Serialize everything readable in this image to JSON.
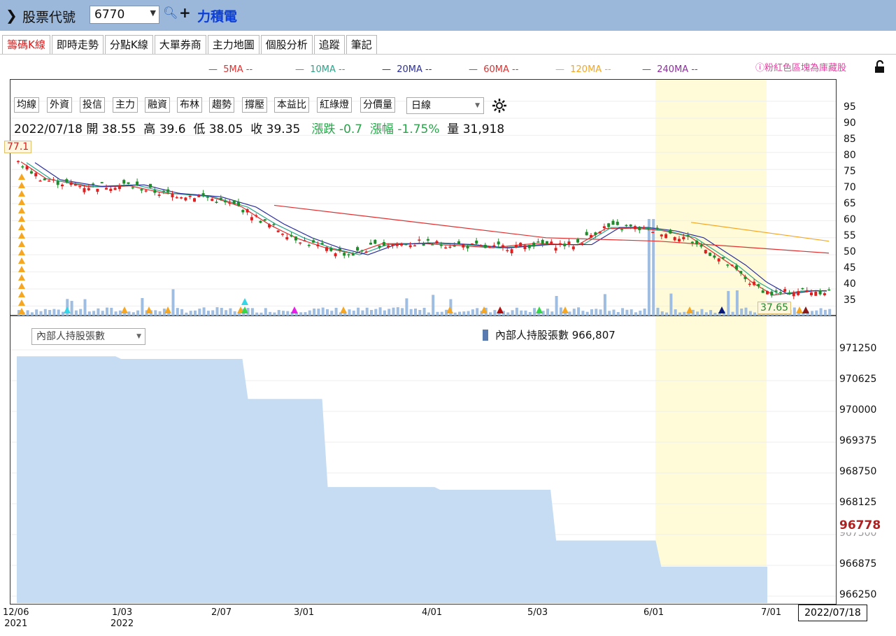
{
  "header": {
    "stock_code_label": "股票代號",
    "stock_code": "6770",
    "stock_name": "力積電"
  },
  "tabs": [
    {
      "label": "籌碼K線",
      "active": true
    },
    {
      "label": "即時走勢"
    },
    {
      "label": "分點K線"
    },
    {
      "label": "大單券商"
    },
    {
      "label": "主力地圖"
    },
    {
      "label": "個股分析"
    },
    {
      "label": "追蹤"
    },
    {
      "label": "筆記"
    }
  ],
  "ma_legend": [
    {
      "label": "5MA --",
      "color": "#e03030"
    },
    {
      "label": "10MA --",
      "color": "#2aa58a"
    },
    {
      "label": "20MA --",
      "color": "#2b2f9c"
    },
    {
      "label": "60MA --",
      "color": "#e03030"
    },
    {
      "label": "120MA --",
      "color": "#f5a623"
    },
    {
      "label": "240MA --",
      "color": "#8e2fa0"
    }
  ],
  "pink_note": "粉紅色區塊為庫藏股",
  "toolbar": {
    "buttons": [
      "均線",
      "外資",
      "投信",
      "主力",
      "融資",
      "布林",
      "趨勢",
      "撐壓",
      "本益比",
      "紅綠燈",
      "分價量"
    ],
    "period": "日線"
  },
  "quote": {
    "date": "2022/07/18",
    "open_label": "開",
    "open": "38.55",
    "high_label": "高",
    "high": "39.6",
    "low_label": "低",
    "low": "38.05",
    "close_label": "收",
    "close": "39.35",
    "change_label": "漲跌",
    "change": "-0.7",
    "pct_label": "漲幅",
    "pct": "-1.75%",
    "vol_label": "量",
    "vol": "31,918"
  },
  "price_badges": {
    "high": "77.1",
    "low": "37.65"
  },
  "price_axis": [
    "95",
    "90",
    "85",
    "80",
    "75",
    "70",
    "65",
    "60",
    "55",
    "50",
    "45",
    "40",
    "35"
  ],
  "insider": {
    "selector": "內部人持股張數",
    "legend": "內部人持股張數 966,807",
    "current_label": "96778",
    "axis": [
      "971250",
      "970625",
      "970000",
      "969375",
      "968750",
      "968125",
      "967500",
      "966875",
      "966250"
    ]
  },
  "x_axis": [
    {
      "l1": "12/06",
      "l2": "2021"
    },
    {
      "l1": "1/03",
      "l2": "2022"
    },
    {
      "l1": "2/07",
      "l2": ""
    },
    {
      "l1": "3/01",
      "l2": ""
    },
    {
      "l1": "4/01",
      "l2": ""
    },
    {
      "l1": "5/03",
      "l2": ""
    },
    {
      "l1": "6/01",
      "l2": ""
    },
    {
      "l1": "7/01",
      "l2": ""
    }
  ],
  "selected_date": "2022/07/18",
  "colors": {
    "up": "#e02020",
    "down": "#1e8c2a",
    "highlight": "#fffbd8",
    "insider_fill": "#c5dcf2",
    "volume": "#9fbde0"
  },
  "chart_data": {
    "type": "candlestick",
    "price_range": [
      32,
      98
    ],
    "insider_range": [
      966100,
      971500
    ],
    "insider_steps": [
      {
        "date": "2021/12/06",
        "value": 970750
      },
      {
        "date": "2022/01/03",
        "value": 970700
      },
      {
        "date": "2022/02/07",
        "value": 969950
      },
      {
        "date": "2022/03/01",
        "value": 968300
      },
      {
        "date": "2022/04/01",
        "value": 968250
      },
      {
        "date": "2022/05/03",
        "value": 967300
      },
      {
        "date": "2022/06/01",
        "value": 966807
      },
      {
        "date": "2022/07/18",
        "value": 966807
      }
    ],
    "ma_60": [
      {
        "date": "2022/02/15",
        "value": 64.5
      },
      {
        "date": "2022/05/01",
        "value": 55
      },
      {
        "date": "2022/06/01",
        "value": 54
      },
      {
        "date": "2022/07/18",
        "value": 50.5
      }
    ],
    "ma_120": [
      {
        "date": "2022/06/10",
        "value": 59.5
      },
      {
        "date": "2022/07/18",
        "value": 54
      }
    ]
  }
}
